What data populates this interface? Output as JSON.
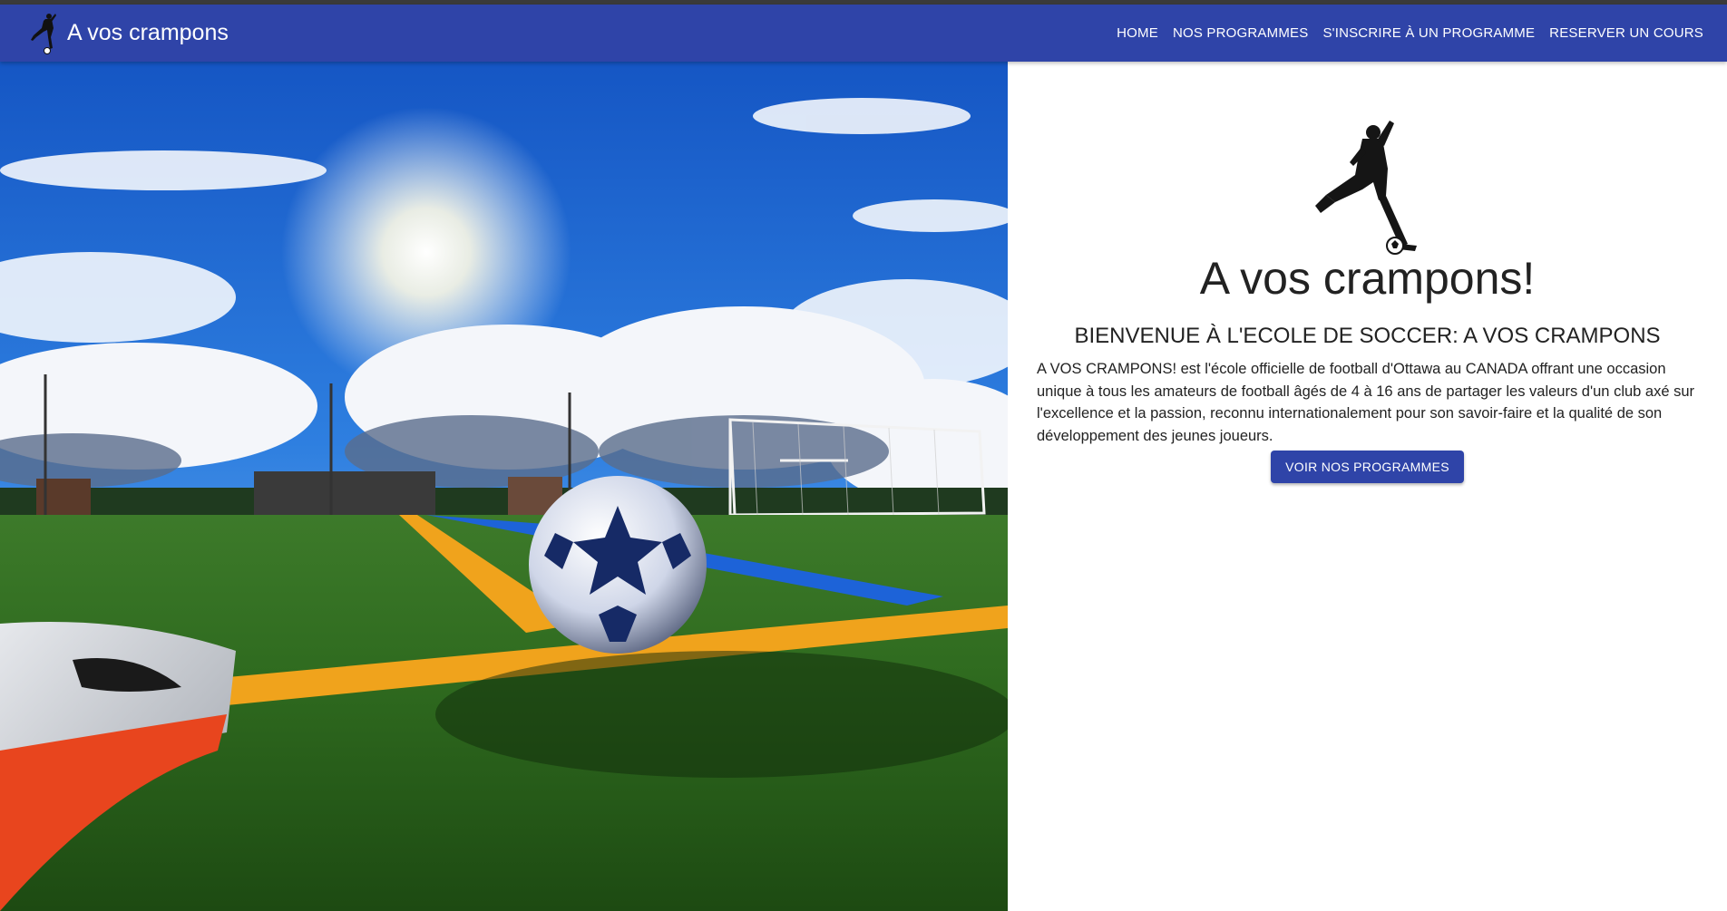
{
  "appbar": {
    "brand_title": "A vos crampons",
    "brand_icon": "soccer-player-icon",
    "background_color": "#2f44a8",
    "nav": [
      {
        "label": "HOME"
      },
      {
        "label": "NOS PROGRAMMES"
      },
      {
        "label": "S'INSCRIRE À UN PROGRAMME"
      },
      {
        "label": "RESERVER UN COURS"
      }
    ]
  },
  "hero_image": {
    "alt_subject": "soccer-ball-on-field-photo"
  },
  "content": {
    "logo_icon": "soccer-player-kick-icon",
    "title": "A vos crampons!",
    "subtitle": "BIENVENUE À L'ECOLE DE SOCCER: A VOS CRAMPONS",
    "description": "A VOS CRAMPONS! est l'école officielle de football d'Ottawa au CANADA offrant une occasion unique à tous les amateurs de football âgés de 4 à 16 ans de partager les valeurs d'un club axé sur l'excellence et la passion, reconnu internationalement pour son savoir-faire et la qualité de son développement des jeunes joueurs.",
    "cta_label": "VOIR NOS PROGRAMMES"
  }
}
